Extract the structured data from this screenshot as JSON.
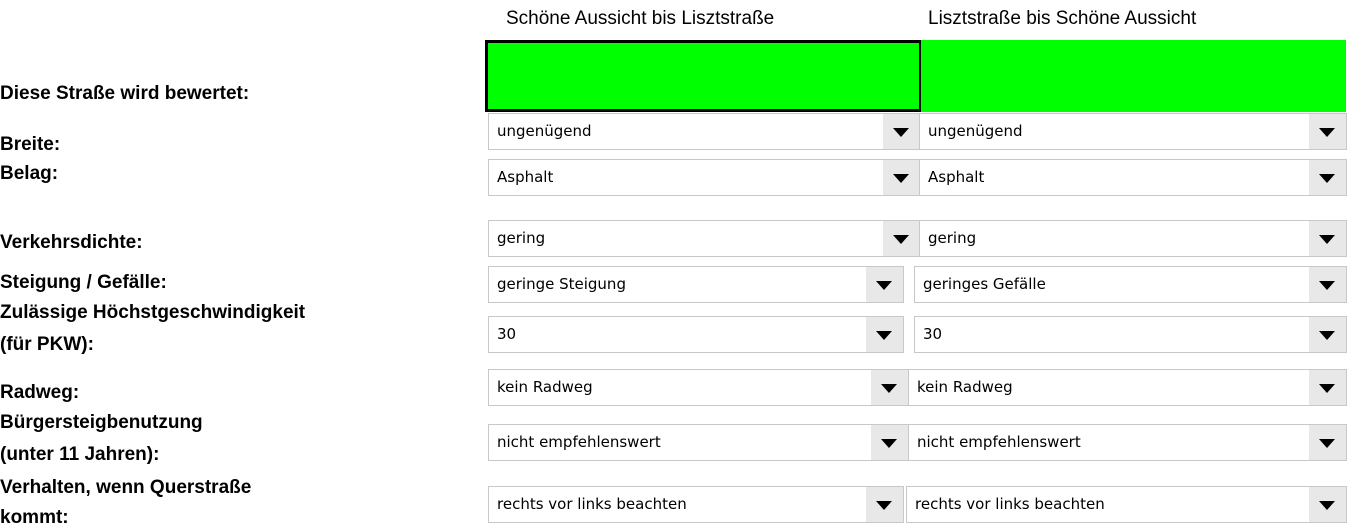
{
  "columns": {
    "left": "Schöne Aussicht bis Lisztstraße",
    "right": "Lisztstraße bis Schöne Aussicht"
  },
  "labels": {
    "rated_street": "Diese Straße wird bewertet:",
    "width": "Breite:",
    "surface": "Belag:",
    "traffic": "Verkehrsdichte:",
    "slope": "Steigung / Gefälle:",
    "speed_line1": "Zulässige Höchstgeschwindigkeit",
    "speed_line2": "(für PKW):",
    "bike_lane": "Radweg:",
    "sidewalk_line1": "Bürgersteigbenutzung",
    "sidewalk_line2": "(unter 11 Jahren):",
    "crossing_line1": "Verhalten, wenn Querstraße",
    "crossing_line2": "kommt:"
  },
  "rating_colors": {
    "left": "#00ff00",
    "right": "#00ff00"
  },
  "fields": {
    "width": {
      "left": "ungenügend",
      "right": "ungenügend"
    },
    "surface": {
      "left": "Asphalt",
      "right": "Asphalt"
    },
    "traffic": {
      "left": "gering",
      "right": "gering"
    },
    "slope": {
      "left": "geringe Steigung",
      "right": "geringes Gefälle"
    },
    "speed": {
      "left": "30",
      "right": "30"
    },
    "bike_lane": {
      "left": "kein Radweg",
      "right": "kein Radweg"
    },
    "sidewalk": {
      "left": "nicht empfehlenswert",
      "right": "nicht empfehlenswert"
    },
    "crossing": {
      "left": "rechts vor links beachten",
      "right": "rechts vor links beachten"
    }
  },
  "icons": {
    "dropdown": "triangle-down-icon"
  }
}
